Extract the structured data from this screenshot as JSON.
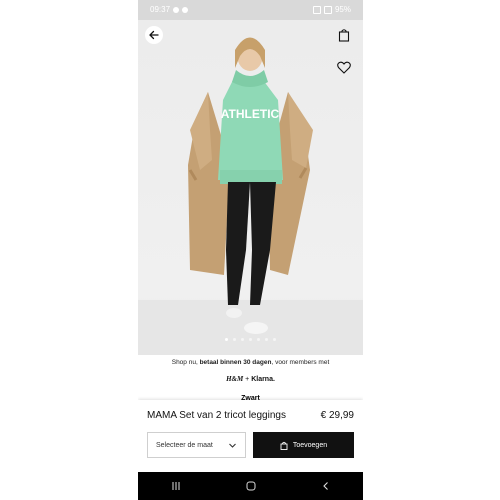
{
  "status_bar": {
    "time": "09:37",
    "battery": "95%"
  },
  "product_image": {
    "alt": "Model wearing mint hoodie with ATHLETIC print, black leggings and beige trench coat",
    "hoodie_text": "ATHLETIC",
    "page_count": 7,
    "active_page": 1
  },
  "icons": {
    "back": "arrow-left-icon",
    "bag": "shopping-bag-icon",
    "wishlist": "heart-icon",
    "bag_button": "bag-icon",
    "chevron": "chevron-down-icon"
  },
  "info": {
    "shop_prefix": "Shop nu, ",
    "shop_bold": "betaal binnen 30 dagen",
    "shop_suffix": ", voor members met",
    "hm_logo": "H&M",
    "plus": "+",
    "klarna": "Klarna.",
    "color_label": "Zwart"
  },
  "product": {
    "name": "MAMA Set van 2 tricot leggings",
    "price": "€ 29,99"
  },
  "actions": {
    "size_placeholder": "Selecteer de maat",
    "add_label": "Toevoegen"
  },
  "colors": {
    "hoodie": "#8fd9b6",
    "coat": "#c9a77c",
    "leggings": "#1a1a1a",
    "button": "#111111"
  }
}
